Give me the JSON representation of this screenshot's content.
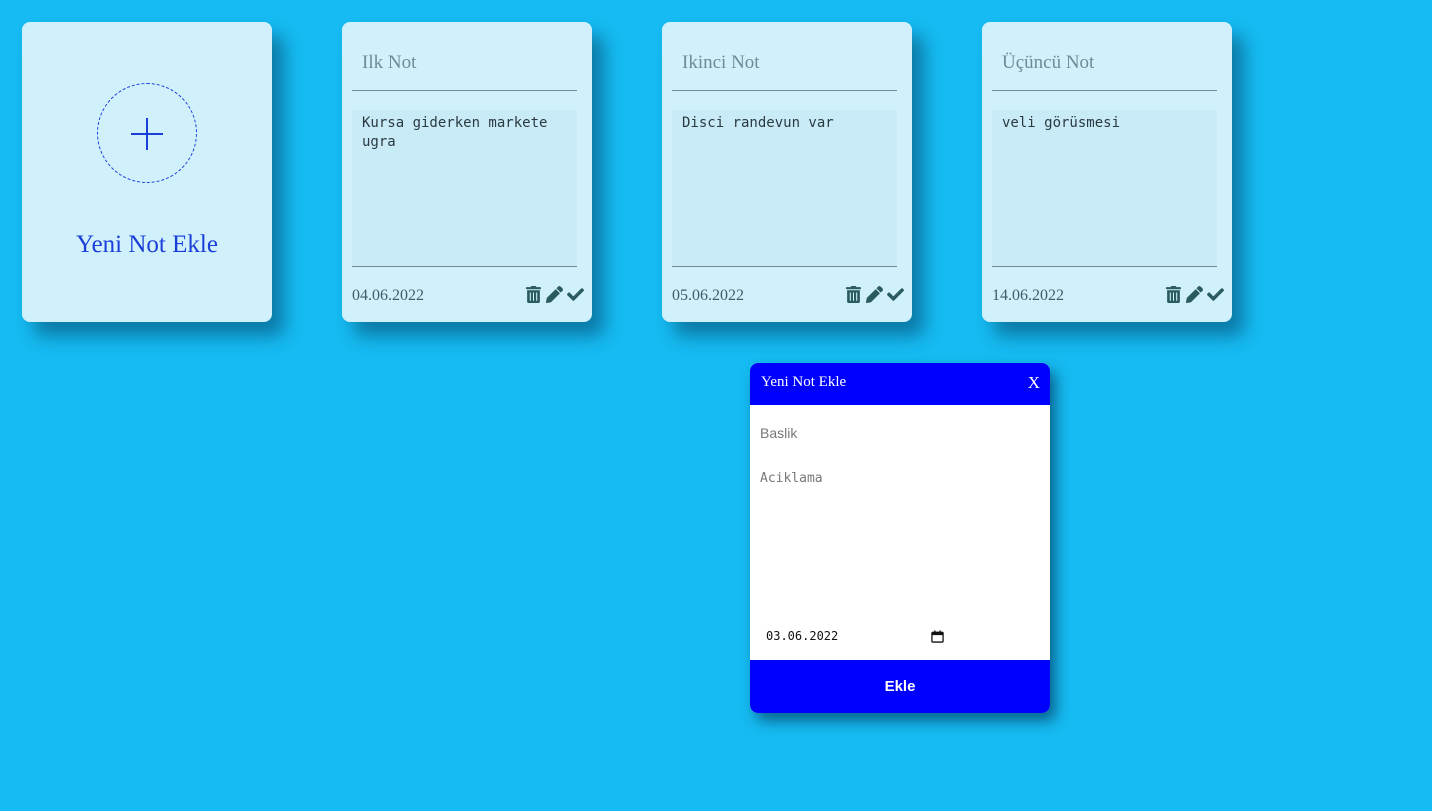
{
  "add_card": {
    "label": "Yeni Not Ekle"
  },
  "notes": [
    {
      "title": "Ilk Not",
      "body": "Kursa giderken markete ugra",
      "date": "04.06.2022"
    },
    {
      "title": "Ikinci Not",
      "body": "Disci randevun var",
      "date": "05.06.2022"
    },
    {
      "title": "Üçüncü Not",
      "body": "veli görüsmesi",
      "date": "14.06.2022"
    }
  ],
  "note_actions": [
    "trash-icon",
    "pencil-icon",
    "check-icon"
  ],
  "modal": {
    "title": "Yeni Not Ekle",
    "close_label": "X",
    "title_placeholder": "Baslik",
    "desc_placeholder": "Aciklama",
    "date_value": "03.06.2022",
    "submit_label": "Ekle"
  },
  "colors": {
    "background": "#15bbf2",
    "card": "#d0f0fc",
    "accent": "#0000ff",
    "icon": "#2a5b5d"
  }
}
